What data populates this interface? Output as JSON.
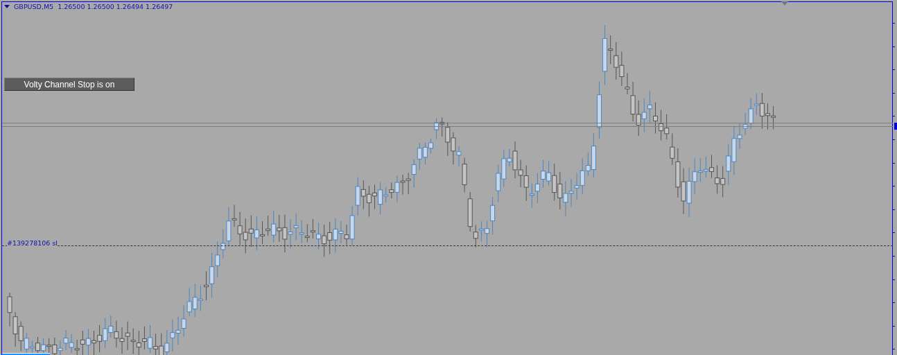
{
  "chart_header": {
    "symbol": "GBPUSD,M5",
    "prices": "1.26500 1.26500 1.26494 1.26497",
    "expanded": true
  },
  "status_button": {
    "label": "Volty Channel Stop is on"
  },
  "order_line": {
    "label": "#139278106 sl"
  }
}
